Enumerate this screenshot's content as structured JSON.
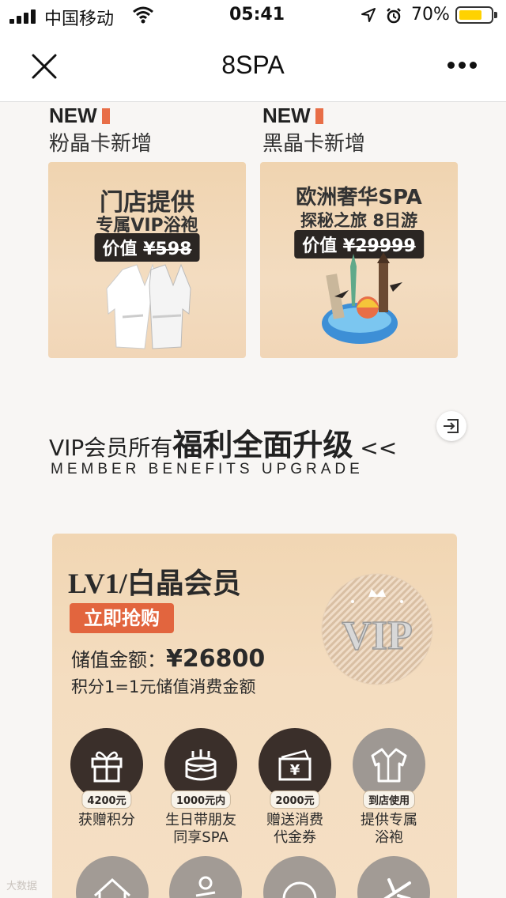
{
  "status_bar": {
    "carrier": "中国移动",
    "time": "05:41",
    "battery": "70%"
  },
  "nav": {
    "title": "8SPA"
  },
  "promos": [
    {
      "badge": "NEW",
      "subtitle": "粉晶卡新增",
      "title_line1": "门店提供",
      "title_line2": "专属VIP浴袍",
      "price_label": "价值",
      "price_value": "¥598"
    },
    {
      "badge": "NEW",
      "subtitle": "黑晶卡新增",
      "title_line1": "欧洲奢华SPA",
      "title_line2": "探秘之旅 8日游",
      "price_label": "价值",
      "price_value": "¥29999"
    }
  ],
  "vip_heading": {
    "prefix": "VIP会员所有",
    "emphasis": "福利全面升级",
    "suffix": " <<",
    "english": "MEMBER BENEFITS UPGRADE"
  },
  "member": {
    "level": "LV1/白晶会员",
    "buy_button": "立即抢购",
    "stored_label": "储值金额：",
    "stored_value": "¥26800",
    "points_note": "积分1=1元储值消费金额",
    "badge_text": "VIP"
  },
  "benefits": [
    {
      "tag": "4200元",
      "label": "获赠积分",
      "icon": "gift-icon"
    },
    {
      "tag": "1000元内",
      "label": "生日带朋友\n同享SPA",
      "icon": "cake-icon"
    },
    {
      "tag": "2000元",
      "label": "赠送消费\n代金券",
      "icon": "voucher-icon"
    },
    {
      "tag": "到店使用",
      "label": "提供专属\n浴袍",
      "icon": "robe-icon"
    }
  ],
  "watermark": "大数据"
}
